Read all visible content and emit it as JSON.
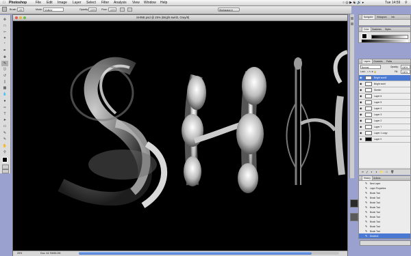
{
  "menubar": {
    "app_name": "Photoshop",
    "items": [
      "File",
      "Edit",
      "Image",
      "Layer",
      "Select",
      "Filter",
      "Analysis",
      "View",
      "Window",
      "Help"
    ],
    "clock": "Tue 14:59"
  },
  "options_bar": {
    "brush_label": "Brush:",
    "brush_size": "100",
    "mode_label": "Mode:",
    "mode_value": "Multiply",
    "opacity_label": "Opacity:",
    "opacity_value": "100%",
    "flow_label": "Flow:",
    "flow_value": "100%",
    "workspace_label": "Workspace"
  },
  "document": {
    "title": "SHINE.psd @ 25% (Bright swirl2, Gray/8)",
    "zoom": "25%",
    "doc_size": "Doc: 44.7M/65.2M",
    "canvas_letters": [
      "S",
      "H",
      "I",
      "N"
    ]
  },
  "navigator_panel": {
    "tabs": [
      "Navigator",
      "Histogram",
      "Info"
    ]
  },
  "color_panel": {
    "tabs": [
      "Color",
      "Swatches",
      "Styles"
    ]
  },
  "layers_panel": {
    "tabs": [
      "Layers",
      "Channels",
      "Paths"
    ],
    "blend_mode": "Normal",
    "opacity_label": "Opacity:",
    "opacity_value": "100%",
    "lock_label": "Lock:",
    "fill_label": "Fill:",
    "fill_value": "100%",
    "layers": [
      {
        "name": "Bright swirl2",
        "selected": true,
        "dark": false
      },
      {
        "name": "Bright swirl",
        "selected": false,
        "dark": false
      },
      {
        "name": "Sketch",
        "selected": false,
        "dark": false
      },
      {
        "name": "Layer 6",
        "selected": false,
        "dark": false
      },
      {
        "name": "Layer 5",
        "selected": false,
        "dark": false
      },
      {
        "name": "Layer 4",
        "selected": false,
        "dark": false
      },
      {
        "name": "Layer 3",
        "selected": false,
        "dark": false
      },
      {
        "name": "Layer 2",
        "selected": false,
        "dark": false
      },
      {
        "name": "Layer 7",
        "selected": false,
        "dark": false
      },
      {
        "name": "Layer 1 copy",
        "selected": false,
        "dark": false
      },
      {
        "name": "Layer 0",
        "selected": false,
        "dark": true
      }
    ]
  },
  "history_panel": {
    "tabs": [
      "History",
      "Actions"
    ],
    "items": [
      {
        "name": "New Layer",
        "selected": false
      },
      {
        "name": "Layer Properties",
        "selected": false
      },
      {
        "name": "Brush Tool",
        "selected": false
      },
      {
        "name": "Brush Tool",
        "selected": false
      },
      {
        "name": "Brush Tool",
        "selected": false
      },
      {
        "name": "Brush Tool",
        "selected": false
      },
      {
        "name": "Brush Tool",
        "selected": false
      },
      {
        "name": "Brush Tool",
        "selected": false
      },
      {
        "name": "Brush Tool",
        "selected": false
      },
      {
        "name": "Brush Tool",
        "selected": false
      },
      {
        "name": "Brush Tool",
        "selected": false
      },
      {
        "name": "Deselect",
        "selected": true
      }
    ]
  },
  "colors": {
    "menubar": "#e6e6e6",
    "desktop": "#9aa1cf",
    "selection": "#4a79d3",
    "canvas": "#000000"
  }
}
